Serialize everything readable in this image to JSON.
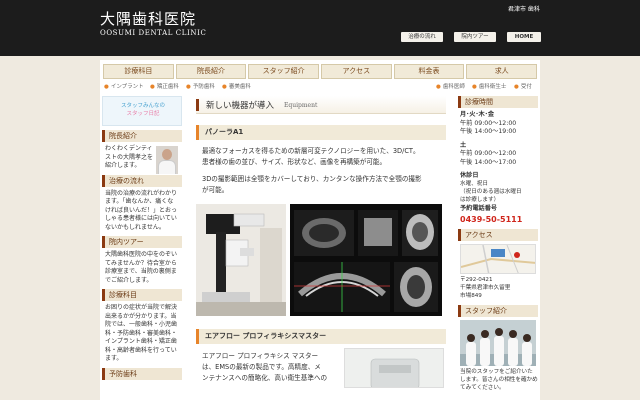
{
  "header": {
    "logo_title": "大隅歯科医院",
    "logo_sub": "OOSUMI DENTAL CLINIC",
    "location": "君津市 歯科",
    "buttons": [
      {
        "label": "治療の流れ"
      },
      {
        "label": "院内ツアー"
      },
      {
        "label": "HOME"
      }
    ]
  },
  "nav": {
    "items": [
      {
        "label": "診療科目"
      },
      {
        "label": "院長紹介"
      },
      {
        "label": "スタッフ紹介"
      },
      {
        "label": "アクセス"
      },
      {
        "label": "料金表"
      },
      {
        "label": "求人"
      }
    ]
  },
  "subnav": {
    "left": [
      "インプラント",
      "矯正歯科",
      "予防歯科",
      "審美歯科"
    ],
    "right": [
      "歯科医師",
      "歯科衛生士",
      "受付"
    ]
  },
  "left": {
    "banner_line1": "スタッフみんなの",
    "banner_line2": "スタッフ日記",
    "director": {
      "head": "院長紹介",
      "text": "わくわくデンティストの大隅孝之を紹介します。"
    },
    "flow": {
      "head": "治療の流れ",
      "text": "当院の治療の流れがわかります。「歯なんか、痛くなければ良いんだ！」とおっしゃる患者様には向いていないかもしれません。"
    },
    "tour": {
      "head": "院内ツアー",
      "text": "大隅歯科医院の中をのぞいてみませんか？待合室から診療室まで、当院の裏側までご紹介します。"
    },
    "subjects": {
      "head": "診療科目",
      "text": "お困りの症状が当院で解決出来るかが分かります。当院では、一般歯科・小児歯科・予防歯科・審美歯科・インプラント歯科・矯正歯科・高齢者歯科を行っています。"
    },
    "prevent": {
      "head": "予防歯科"
    }
  },
  "main": {
    "title": "新しい機器が導入",
    "title_en": "Equipment",
    "section1": {
      "head": "パノーラA1",
      "p1_line1": "最適なフォーカスを得るための新層可変テクノロジーを用いた、3D/CT。",
      "p1_line2": "患者様の歯の並び、サイズ、形状など、画像を再構築が可能。",
      "p2_line1": "3Dの撮影範囲は全顎をカバーしており、カンタンな操作方法で全顎の撮影",
      "p2_line2": "が可能。"
    },
    "section2": {
      "head": "エアフロー プロフィラキシスマスター",
      "p1_line1": "エアフロー プロフィラキシス マスター",
      "p1_line2": "は、EMSの最新の製品です。高精度、メ",
      "p1_line3": "ンテナンスへの簡略化、高い衛生基準への"
    }
  },
  "right": {
    "hours_head": "診療時間",
    "weekday_label": "月･火･木･金",
    "weekday_am": "午前 09:00〜12:00",
    "weekday_pm": "午後 14:00〜19:00",
    "sat_label": "土",
    "sat_am": "午前 09:00〜12:00",
    "sat_pm": "午後 14:00〜17:00",
    "closed_label": "休診日",
    "closed_line1": "水曜、祝日",
    "closed_line2": "（祝日のある週は水曜日",
    "closed_line3": "は診療します）",
    "phone_label": "予約電話番号",
    "phone": "0439-50-5111",
    "access_head": "アクセス",
    "postal": "〒292-0421",
    "address1": "千葉県君津市久留里",
    "address2": "市場849",
    "staff_head": "スタッフ紹介",
    "staff_text": "当院のスタッフをご紹介いたします。皆さんの相性を確かめてみてください。"
  },
  "colors": {
    "header_bg": "#1c1c1c",
    "accent_brown": "#8b3a12",
    "accent_orange": "#e7842a",
    "phone_red": "#d0261c"
  }
}
